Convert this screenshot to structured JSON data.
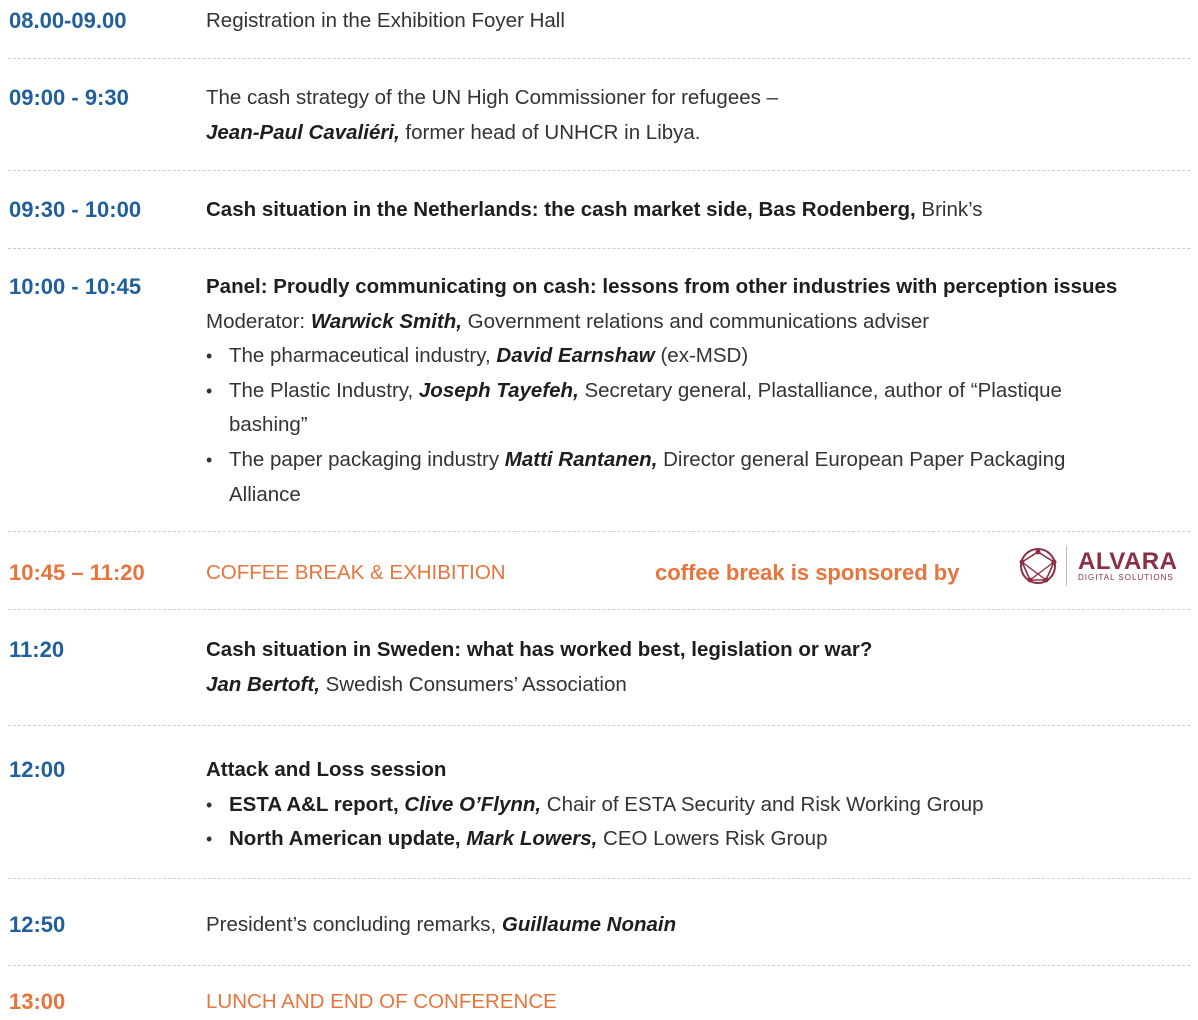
{
  "rows": [
    {
      "time": "08.00-09.00",
      "lines": [
        {
          "parts": [
            {
              "text": "Registration in the Exhibition Foyer Hall",
              "style": "t"
            }
          ]
        }
      ]
    },
    {
      "time": "09:00 - 9:30",
      "lines": [
        {
          "parts": [
            {
              "text": "The cash strategy of the UN High Commissioner for refugees –",
              "style": "t"
            }
          ]
        },
        {
          "parts": [
            {
              "text": "Jean-Paul Cavaliéri,",
              "style": "bi"
            },
            {
              "text": " former head of UNHCR in Libya.",
              "style": "t"
            }
          ]
        }
      ]
    },
    {
      "time": "09:30 - 10:00",
      "lines": [
        {
          "parts": [
            {
              "text": "Cash situation in the Netherlands: the cash market side, Bas Rodenberg,",
              "style": "b"
            },
            {
              "text": " Brink’s",
              "style": "t"
            }
          ]
        }
      ]
    },
    {
      "time": "10:00 - 10:45",
      "lines": [
        {
          "parts": [
            {
              "text": "Panel: Proudly communicating on cash: lessons from other industries with perception issues",
              "style": "b"
            }
          ]
        },
        {
          "parts": [
            {
              "text": "Moderator: ",
              "style": "t"
            },
            {
              "text": "Warwick Smith,",
              "style": "bi"
            },
            {
              "text": " Government relations and communications adviser",
              "style": "t"
            }
          ]
        }
      ],
      "bullets": [
        {
          "lines": [
            [
              {
                "text": "The pharmaceutical industry, ",
                "style": "t"
              },
              {
                "text": "David Earnshaw",
                "style": "bi"
              },
              {
                "text": " (ex-MSD)",
                "style": "t"
              }
            ]
          ]
        },
        {
          "lines": [
            [
              {
                "text": "The Plastic Industry, ",
                "style": "t"
              },
              {
                "text": "Joseph Tayefeh,",
                "style": "bi"
              },
              {
                "text": " Secretary general, Plastalliance, author of “Plastique",
                "style": "t"
              }
            ],
            [
              {
                "text": "bashing”",
                "style": "t"
              }
            ]
          ]
        },
        {
          "lines": [
            [
              {
                "text": "The paper packaging industry ",
                "style": "t"
              },
              {
                "text": "Matti Rantanen,",
                "style": "bi"
              },
              {
                "text": " Director general European Paper Packaging",
                "style": "t"
              }
            ],
            [
              {
                "text": "Alliance",
                "style": "t"
              }
            ]
          ]
        }
      ]
    },
    {
      "time": "10:45 – 11:20",
      "orange": true,
      "lines": [
        {
          "parts": [
            {
              "text": "COFFEE BREAK & EXHIBITION",
              "style": "orange"
            }
          ]
        }
      ],
      "sponsor": "coffee break is sponsored by",
      "logo": {
        "name": "ALVARA",
        "sub": "DIGITAL SOLUTIONS"
      }
    },
    {
      "time": "11:20",
      "lines": [
        {
          "parts": [
            {
              "text": "Cash situation in Sweden: what has worked best, legislation or war?",
              "style": "b"
            }
          ]
        },
        {
          "parts": [
            {
              "text": "Jan Bertoft,",
              "style": "bi"
            },
            {
              "text": " Swedish Consumers’ Association",
              "style": "t"
            }
          ]
        }
      ]
    },
    {
      "time": "12:00",
      "lines": [
        {
          "parts": [
            {
              "text": "Attack and Loss session",
              "style": "b"
            }
          ]
        }
      ],
      "bullets": [
        {
          "lines": [
            [
              {
                "text": "ESTA A&L report, ",
                "style": "b"
              },
              {
                "text": "Clive O’Flynn,",
                "style": "bi"
              },
              {
                "text": " Chair of ESTA Security and Risk Working Group",
                "style": "t"
              }
            ]
          ]
        },
        {
          "lines": [
            [
              {
                "text": "North American update, ",
                "style": "b"
              },
              {
                "text": "Mark Lowers,",
                "style": "bi"
              },
              {
                "text": " CEO Lowers Risk Group",
                "style": "t"
              }
            ]
          ]
        }
      ]
    },
    {
      "time": "12:50",
      "lines": [
        {
          "parts": [
            {
              "text": "President’s concluding remarks, ",
              "style": "t"
            },
            {
              "text": "Guillaume Nonain",
              "style": "bi"
            }
          ]
        }
      ]
    },
    {
      "time": "13:00",
      "orange": true,
      "lines": [
        {
          "parts": [
            {
              "text": "LUNCH AND END OF CONFERENCE",
              "style": "orange"
            }
          ]
        }
      ]
    }
  ]
}
